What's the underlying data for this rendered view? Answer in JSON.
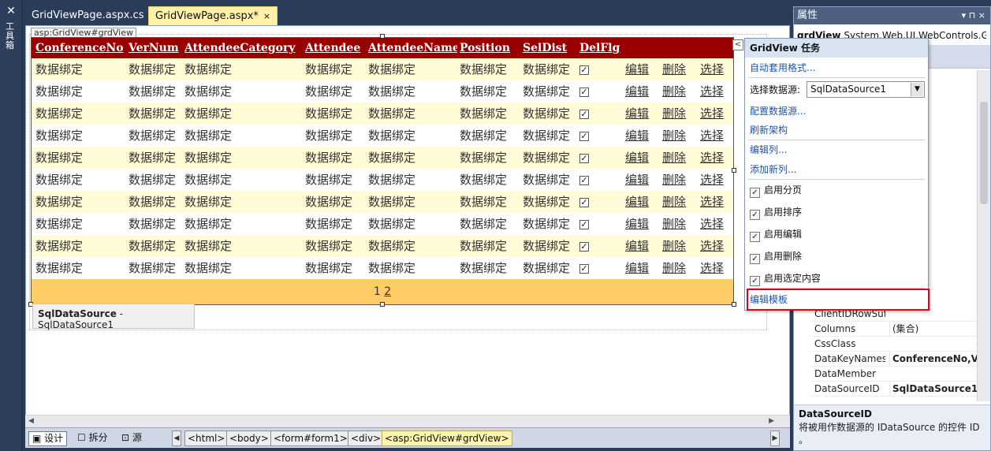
{
  "toolbox": {
    "label": "工具箱",
    "icon": "toolbox-icon"
  },
  "tabs": [
    {
      "label": "GridViewPage.aspx.cs"
    },
    {
      "label": "GridViewPage.aspx*",
      "close": "×"
    }
  ],
  "designer": {
    "selected_tag": "asp:GridView#grdView",
    "grid": {
      "headers": [
        "ConferenceNo",
        "VerNum",
        "AttendeeCategory",
        "Attendee",
        "AttendeeName",
        "Position",
        "SelDist",
        "DelFlg"
      ],
      "placeholder": "数据绑定",
      "checkbox_mark": "✓",
      "row_actions": [
        "编辑",
        "删除",
        "选择"
      ],
      "row_count": 10,
      "pager": {
        "current": "1",
        "next": "2"
      },
      "colors": {
        "header_bg": "#990000",
        "alt_row_bg": "#fffbd6",
        "pager_bg": "#ffcc66"
      }
    },
    "datasource_control": {
      "type": "SqlDataSource",
      "id": "SqlDataSource1"
    }
  },
  "statusbar": {
    "views": [
      "设计",
      "拆分",
      "源"
    ],
    "breadcrumbs": [
      "<html>",
      "<body>",
      "<form#form1>",
      "<div>",
      "<asp:GridView#grdView>"
    ]
  },
  "smart_tag": {
    "toggle_glyph": "<",
    "title": "GridView 任务",
    "auto_format": "自动套用格式...",
    "choose_datasource_label": "选择数据源:",
    "choose_datasource_value": "SqlDataSource1",
    "configure_datasource": "配置数据源...",
    "refresh_schema": "刷新架构",
    "edit_columns": "编辑列...",
    "add_column": "添加新列...",
    "checks": [
      {
        "label": "启用分页",
        "checked": true
      },
      {
        "label": "启用排序",
        "checked": true
      },
      {
        "label": "启用编辑",
        "checked": true
      },
      {
        "label": "启用删除",
        "checked": true
      },
      {
        "label": "启用选定内容",
        "checked": true
      }
    ],
    "edit_templates": "编辑模板",
    "highlight_color": "#e0001b"
  },
  "properties": {
    "title": "属性",
    "title_controls": "▾ ⊓ ×",
    "object_name": "grdView",
    "object_type": "System.Web.UI.WebControls.G",
    "rows": [
      {
        "name": "ClientIDRowSuff",
        "value": ""
      },
      {
        "name": "Columns",
        "value": "(集合)"
      },
      {
        "name": "CssClass",
        "value": ""
      },
      {
        "name": "DataKeyNames",
        "value": "ConferenceNo,Ver",
        "bold": true
      },
      {
        "name": "DataMember",
        "value": ""
      },
      {
        "name": "DataSourceID",
        "value": "SqlDataSource1",
        "bold": true
      }
    ],
    "description_title": "DataSourceID",
    "description_text": "将被用作数据源的 IDataSource 的控件 ID 。"
  }
}
